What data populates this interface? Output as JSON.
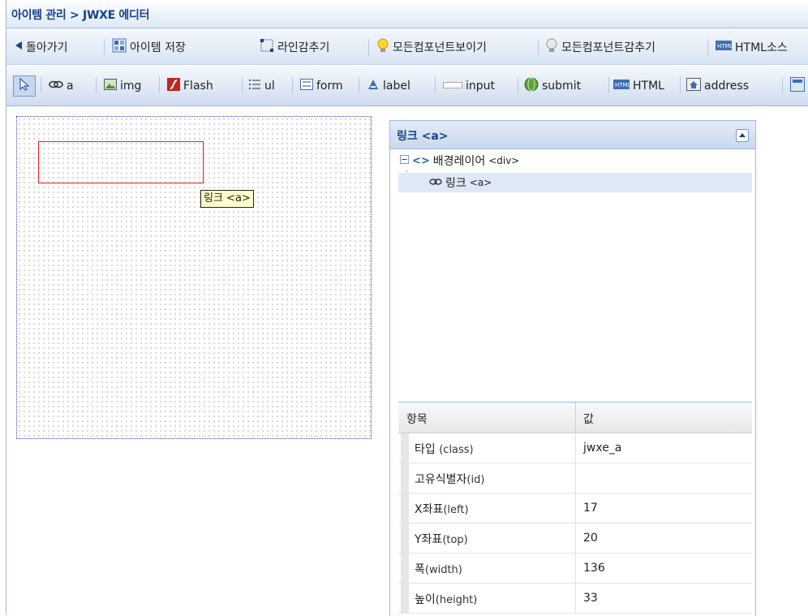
{
  "header": {
    "title": "아이템 관리 > JWXE 에디터"
  },
  "toolbar1": {
    "back": "돌아가기",
    "save": "아이템 저장",
    "hide_lines": "라인감추기",
    "show_all": "모든컴포넌트보이기",
    "hide_all": "모든컴포넌트감추기",
    "html_source": "HTML소스"
  },
  "toolbar2": {
    "a": "a",
    "img": "img",
    "flash": "Flash",
    "ul": "ul",
    "form": "form",
    "label": "label",
    "input": "input",
    "submit": "submit",
    "html": "HTML",
    "address": "address"
  },
  "canvas": {
    "tooltip": "링크 <a>"
  },
  "panel": {
    "title": "링크 <a>",
    "tree": {
      "root_label": "배경레이어",
      "root_tag": "<div>",
      "child_label": "링크",
      "child_tag": "<a>"
    },
    "grid": {
      "header_key": "항목",
      "header_value": "값",
      "rows": [
        {
          "key": "타입",
          "sub": "(class)",
          "value": "jwxe_a"
        },
        {
          "key": "고유식별자",
          "sub": "(id)",
          "value": ""
        },
        {
          "key": "X좌표",
          "sub": "(left)",
          "value": "17"
        },
        {
          "key": "Y좌표",
          "sub": "(top)",
          "value": "20"
        },
        {
          "key": "폭",
          "sub": "(width)",
          "value": "136"
        },
        {
          "key": "높이",
          "sub": "(height)",
          "value": "33"
        }
      ]
    }
  },
  "colors": {
    "accent": "#15428b",
    "border": "#99bbe8",
    "selection": "#e02020",
    "tooltip_bg": "#ffffcc"
  }
}
